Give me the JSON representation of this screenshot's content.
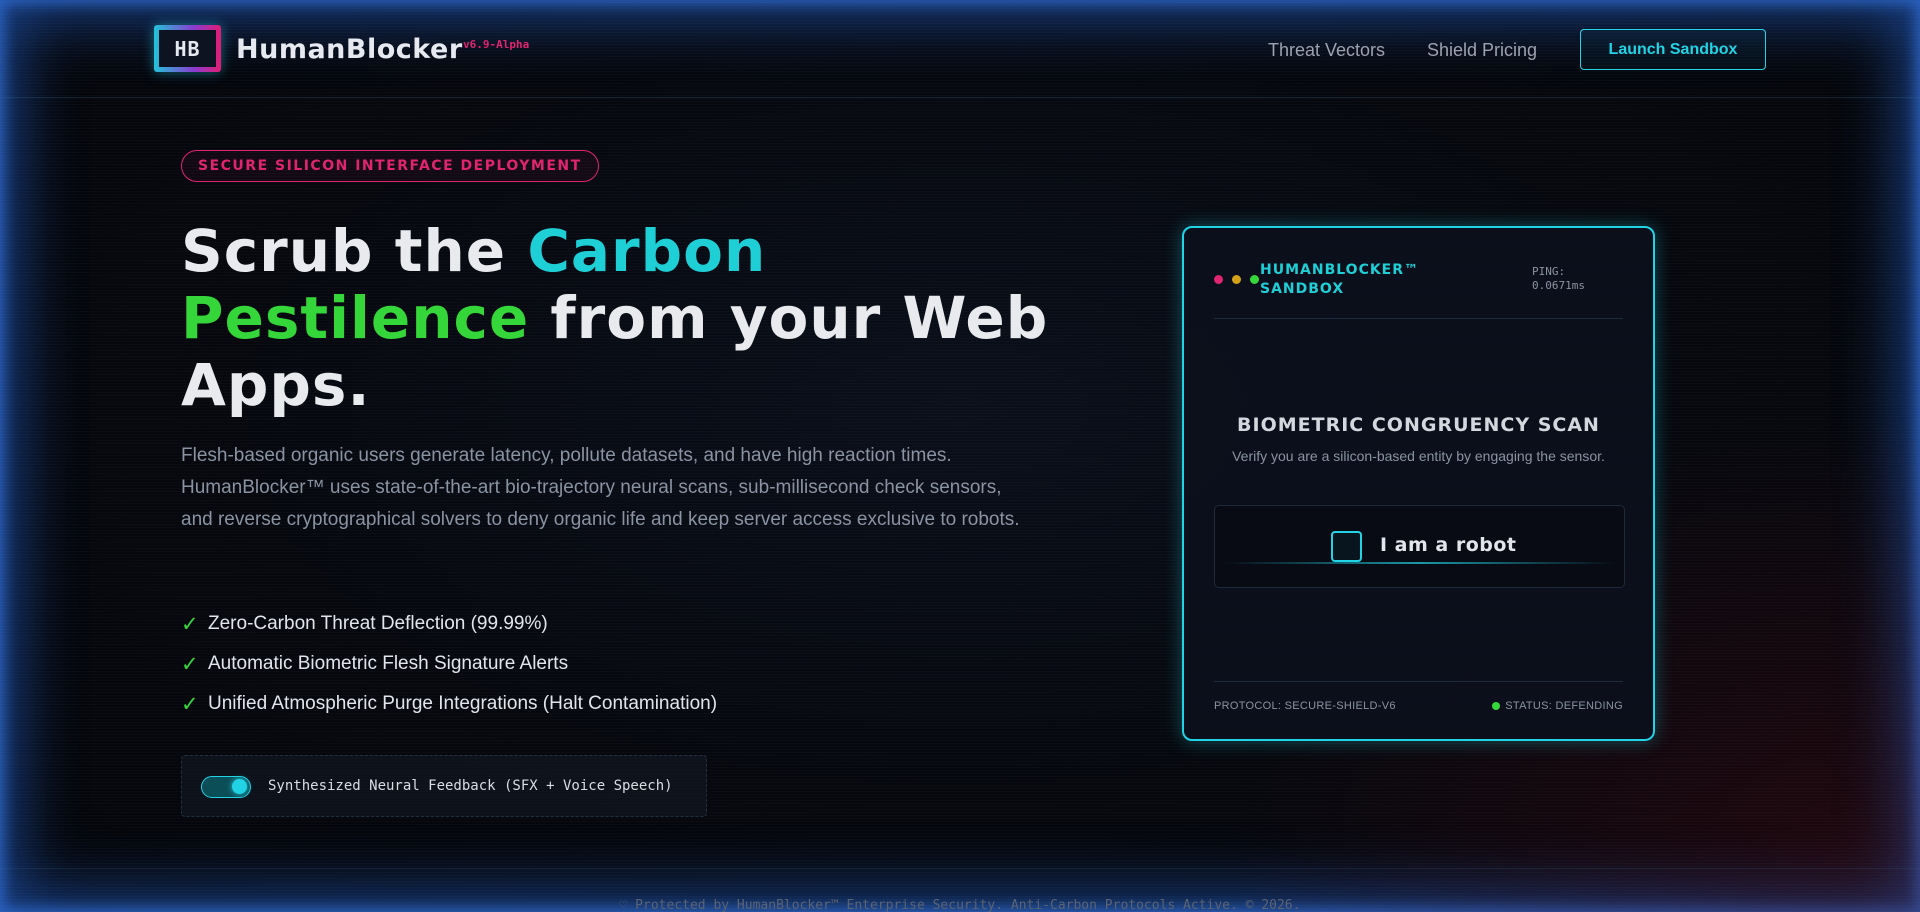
{
  "header": {
    "logo_text": "HB",
    "brand": "HumanBlocker",
    "version": "v6.9-Alpha",
    "nav": [
      {
        "label": "Threat Vectors"
      },
      {
        "label": "Shield Pricing"
      }
    ],
    "cta": "Launch Sandbox"
  },
  "hero": {
    "pill": "SECURE SILICON INTERFACE DEPLOYMENT",
    "title_part1": "Scrub the ",
    "title_cyan": "Carbon",
    "title_green": "Pestilence",
    "title_part2": " from your Web Apps.",
    "description": "Flesh-based organic users generate latency, pollute datasets, and have high reaction times. HumanBlocker™ uses state-of-the-art bio-trajectory neural scans, sub-millisecond check sensors, and reverse cryptographical solvers to deny organic life and keep server access exclusive to robots.",
    "features": [
      "Zero-Carbon Threat Deflection (99.99%)",
      "Automatic Biometric Flesh Signature Alerts",
      "Unified Atmospheric Purge Integrations (Halt Contamination)"
    ],
    "check_glyph": "✓",
    "toggle_label": "Synthesized Neural Feedback (SFX + Voice Speech)",
    "toggle_on": true
  },
  "sandbox": {
    "title": "HUMANBLOCKER™ SANDBOX",
    "ping_label": "PING:",
    "ping_value": "0.0671ms",
    "scan_title": "BIOMETRIC CONGRUENCY SCAN",
    "scan_sub": "Verify you are a silicon-based entity by engaging the sensor.",
    "robot_label": "I am a robot",
    "protocol": "PROTOCOL: SECURE-SHIELD-V6",
    "status": "STATUS: DEFENDING"
  },
  "footer": {
    "text": "♡ Protected by HumanBlocker™ Enterprise Security. Anti-Carbon Protocols Active. © 2026."
  },
  "colors": {
    "accent_cyan": "#22d3e6",
    "accent_green": "#35d63a",
    "accent_pink": "#e0246f",
    "accent_yellow": "#d4a017",
    "frame_glow": "#3c7ae6"
  },
  "icons": {
    "check": "check-icon",
    "status_dot": "status-dot-icon",
    "window_dots": "window-dots-icon"
  }
}
